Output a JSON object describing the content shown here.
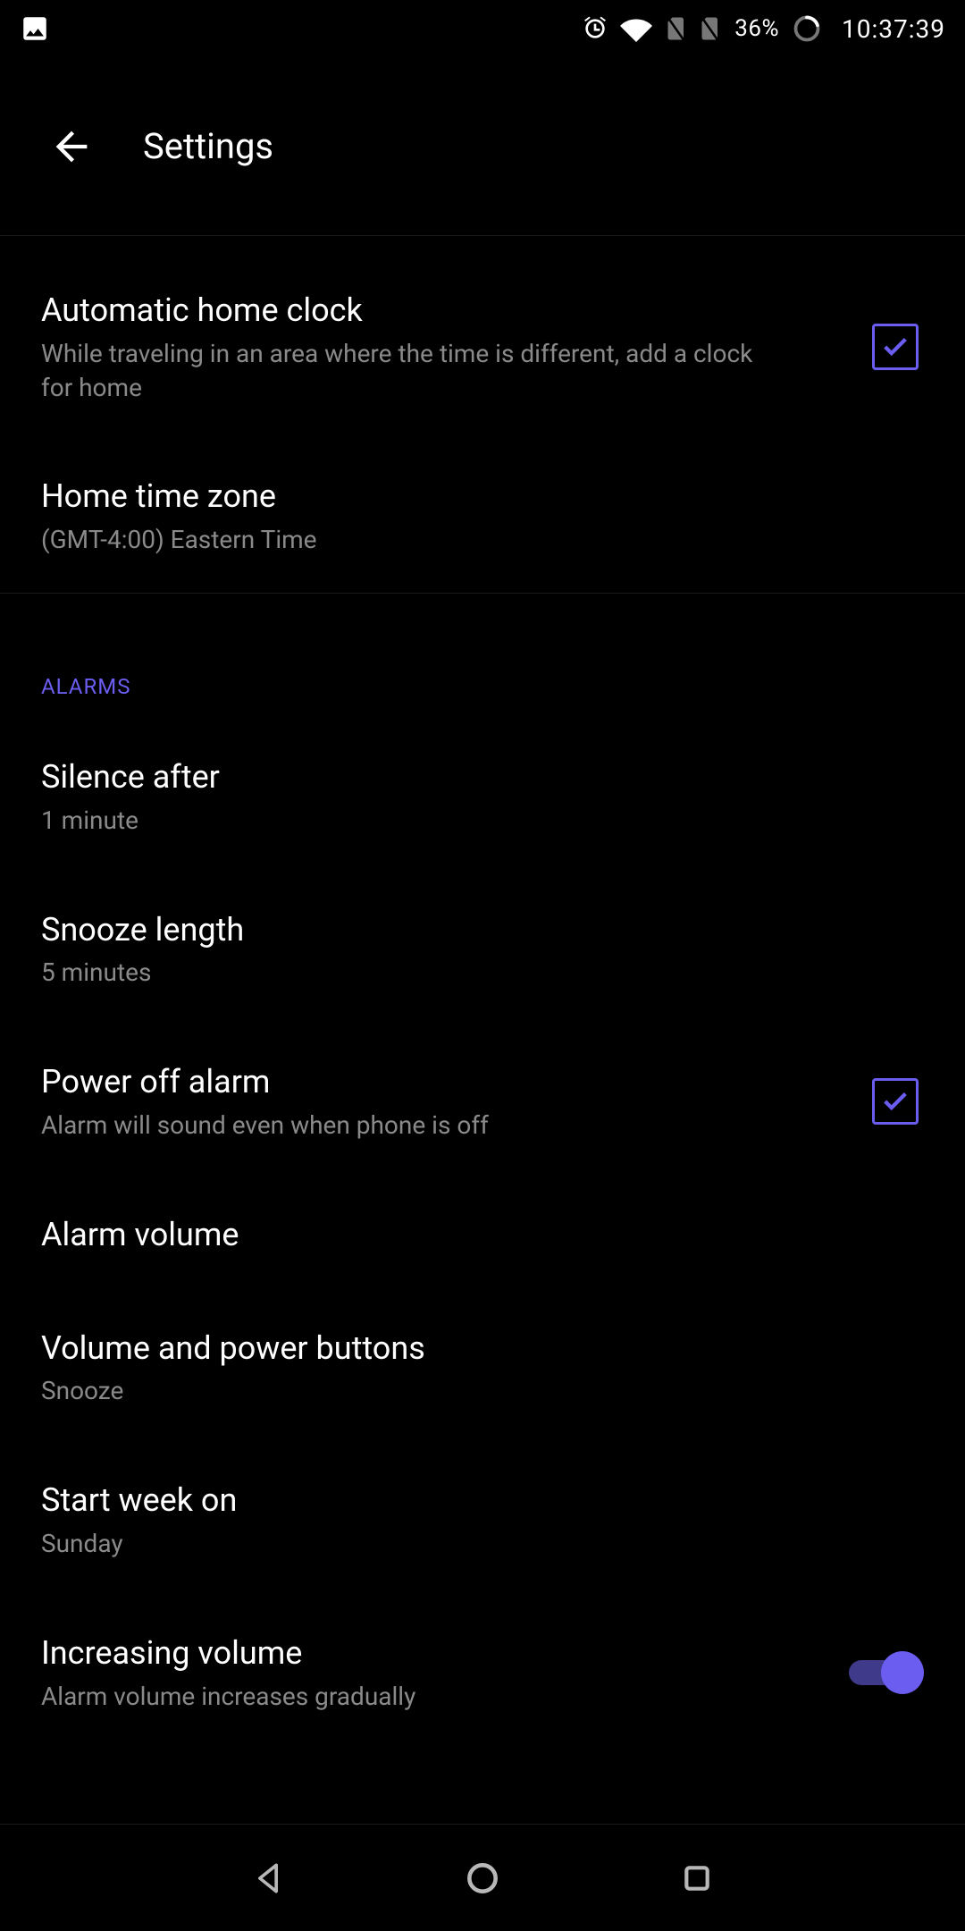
{
  "statusbar": {
    "battery_text": "36%",
    "time": "10:37:39"
  },
  "appbar": {
    "title": "Settings"
  },
  "settings": {
    "auto_home_clock": {
      "title": "Automatic home clock",
      "subtitle": "While traveling in an area where the time is different, add a clock for home",
      "checked": true
    },
    "home_tz": {
      "title": "Home time zone",
      "subtitle": "(GMT-4:00) Eastern Time"
    }
  },
  "sections": {
    "alarms_header": "ALARMS"
  },
  "alarms": {
    "silence_after": {
      "title": "Silence after",
      "subtitle": "1 minute"
    },
    "snooze_length": {
      "title": "Snooze length",
      "subtitle": "5 minutes"
    },
    "power_off_alarm": {
      "title": "Power off alarm",
      "subtitle": "Alarm will sound even when phone is off",
      "checked": true
    },
    "alarm_volume": {
      "title": "Alarm volume"
    },
    "vol_power_buttons": {
      "title": "Volume and power buttons",
      "subtitle": "Snooze"
    },
    "start_week_on": {
      "title": "Start week on",
      "subtitle": "Sunday"
    },
    "increasing_volume": {
      "title": "Increasing volume",
      "subtitle": "Alarm volume increases gradually",
      "on": true
    }
  }
}
